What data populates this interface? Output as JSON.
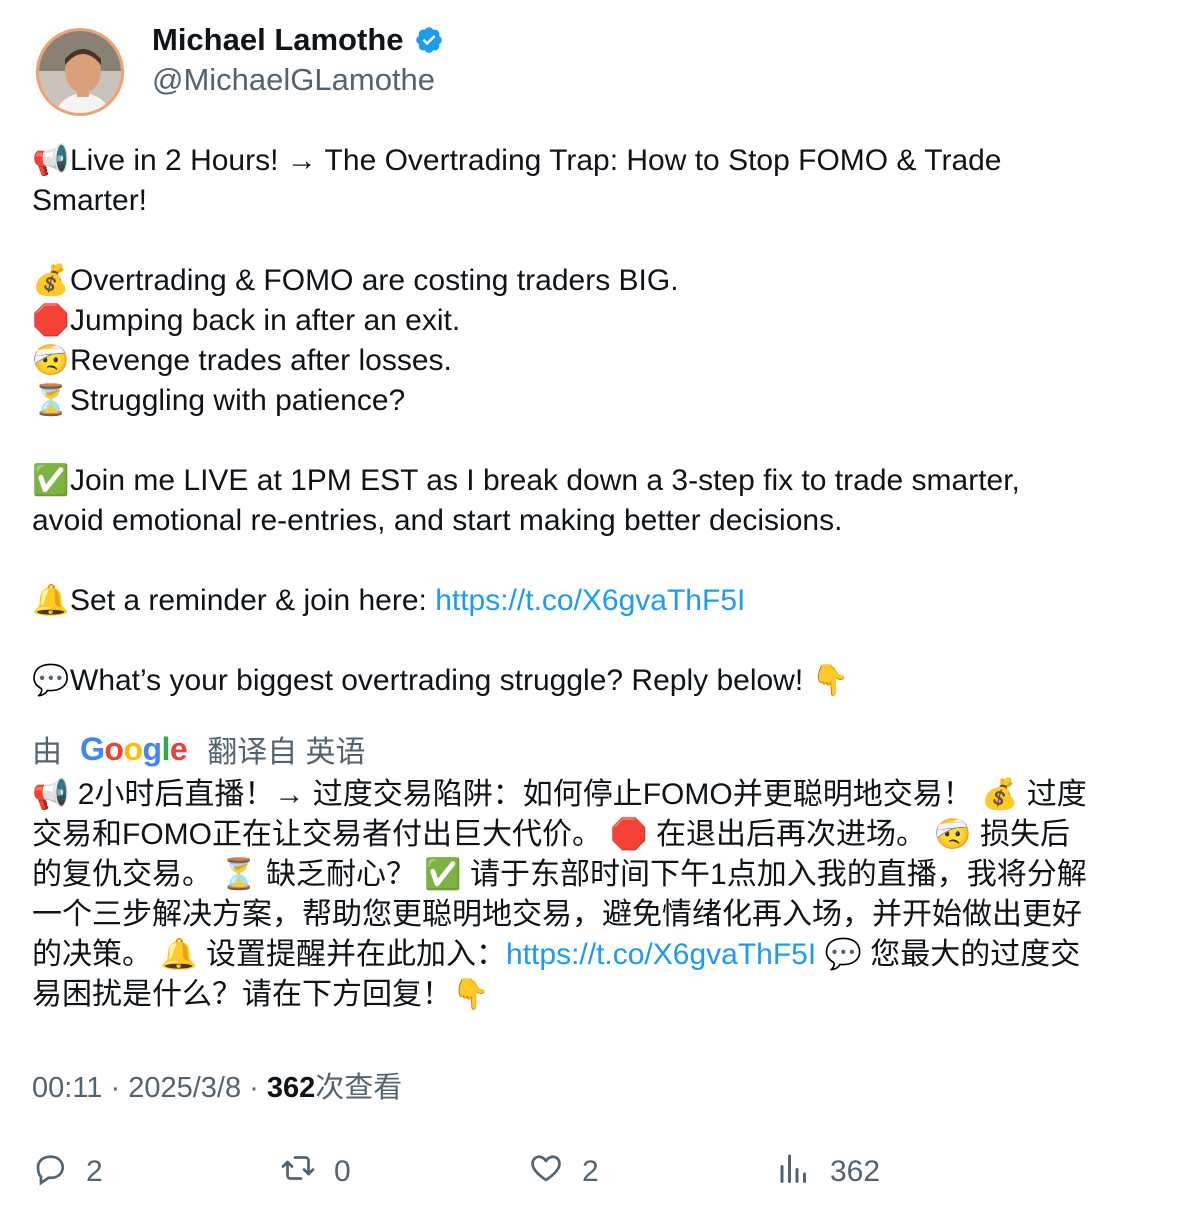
{
  "author": {
    "name": "Michael Lamothe",
    "handle": "@MichaelGLamothe",
    "verified": true
  },
  "tweet": {
    "lines": [
      {
        "emoji": "📢",
        "text": "Live in 2 Hours! → The Overtrading Trap: How to Stop FOMO & Trade"
      },
      {
        "emoji": "",
        "text": "Smarter!"
      },
      {
        "emoji": "💰",
        "text": "Overtrading & FOMO are costing traders BIG."
      },
      {
        "emoji": "🛑",
        "text": "Jumping back in after an exit."
      },
      {
        "emoji": "🤕",
        "text": "Revenge trades after losses."
      },
      {
        "emoji": "⏳",
        "text": "Struggling with patience?"
      },
      {
        "emoji": "✅",
        "text": "Join me LIVE at 1PM EST as I break down a 3-step fix to trade smarter,"
      },
      {
        "emoji": "",
        "text": "avoid emotional re-entries, and start making better decisions."
      },
      {
        "emoji": "🔔",
        "text": "Set a reminder & join here: "
      },
      {
        "emoji": "💬",
        "text": "What’s your biggest overtrading struggle? Reply below! 👇"
      }
    ],
    "link": "https://t.co/X6gvaThF5I"
  },
  "translation": {
    "prefix": "由",
    "google_letters": [
      "G",
      "o",
      "o",
      "g",
      "l",
      "e"
    ],
    "suffix": "翻译自 英语",
    "lines": [
      "📢 2小时后直播！→ 过度交易陷阱：如何停止FOMO并更聪明地交易！ 💰 过度",
      "交易和FOMO正在让交易者付出巨大代价。 🛑 在退出后再次进场。 🤕 损失后",
      "的复仇交易。 ⏳ 缺乏耐心？ ✅ 请于东部时间下午1点加入我的直播，我将分解",
      "一个三步解决方案，帮助您更聪明地交易，避免情绪化再入场，并开始做出更好",
      "的决策。 🔔 设置提醒并在此加入："
    ],
    "line5_after_link": " 💬 您最大的过度交",
    "line6": "易困扰是什么？请在下方回复！👇",
    "link": "https://t.co/X6gvaThF5I"
  },
  "meta": {
    "time": "00:11",
    "sep": " · ",
    "date": "2025/3/8",
    "views_count": "362",
    "views_label": "次查看"
  },
  "actions": {
    "reply_count": "2",
    "retweet_count": "0",
    "like_count": "2",
    "views_count": "362"
  },
  "colors": {
    "link": "#1d9bf0",
    "muted": "#536471",
    "verified": "#1d9bf0"
  }
}
